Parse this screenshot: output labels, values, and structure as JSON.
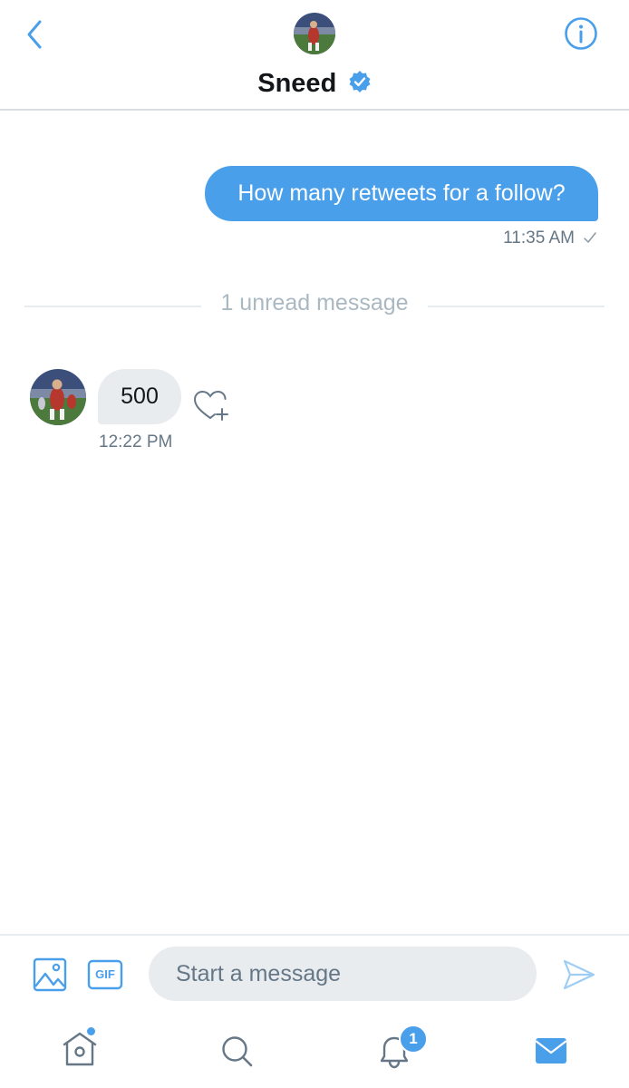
{
  "header": {
    "title": "Sneed",
    "back_icon": "chevron-left-icon",
    "info_icon": "info-circle-icon",
    "verified_icon": "verified-badge-icon"
  },
  "conversation": {
    "outgoing": {
      "text": "How many retweets for a follow?",
      "time": "11:35 AM",
      "status_icon": "check-icon"
    },
    "divider_text": "1 unread message",
    "incoming": {
      "text": "500",
      "time": "12:22 PM",
      "like_icon": "heart-plus-icon"
    }
  },
  "composer": {
    "placeholder": "Start a message",
    "gif_label": "GIF",
    "image_icon": "image-icon",
    "send_icon": "send-icon"
  },
  "tabbar": {
    "notifications_badge": "1",
    "tabs": [
      "home-icon",
      "search-icon",
      "notifications-icon",
      "messages-icon"
    ]
  },
  "colors": {
    "accent": "#4a9feb",
    "incoming_bubble": "#e9ecef",
    "muted_text": "#657786",
    "divider_text": "#aab8c2"
  }
}
